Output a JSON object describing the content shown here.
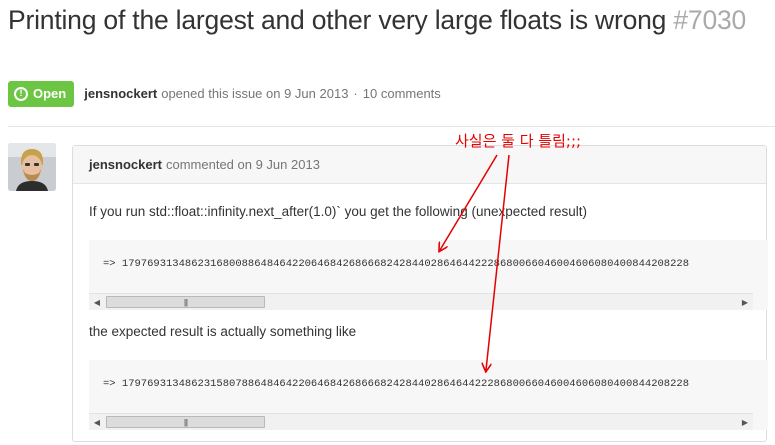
{
  "issue": {
    "title": "Printing of the largest and other very large floats is wrong",
    "number": "#7030",
    "state_label": "Open",
    "author": "jensnockert",
    "opened_text": "opened this issue on 9 Jun 2013",
    "separator": "·",
    "comments_text": "10 comments"
  },
  "comment": {
    "author": "jensnockert",
    "meta": "commented on 9 Jun 2013",
    "paragraph1": "If you run std::float::infinity.next_after(1.0)` you get the following (unexpected result)",
    "code1": "=> 179769313486231680088648464220646842686668242844028646442228680066046004606080400844208228",
    "paragraph2": "the expected result is actually something like",
    "code2": "=> 179769313486231580788648464220646842686668242844028646442228680066046004606080400844208228"
  },
  "scrollbar": {
    "left_arrow": "◀",
    "right_arrow": "▶",
    "grip": "|||"
  },
  "annotation": {
    "text": "사실은 둘 다 틀림;;;",
    "color": "#e60000"
  },
  "icons": {
    "state": "exclamation-circle-icon",
    "avatar": "user-avatar"
  },
  "colors": {
    "open_badge": "#6cc644",
    "number": "#aaaaaa",
    "annotation": "#e60000"
  }
}
